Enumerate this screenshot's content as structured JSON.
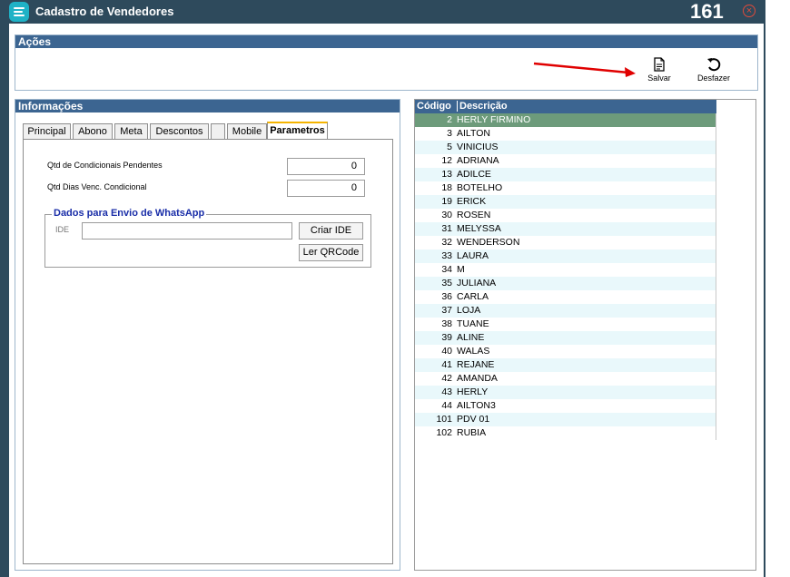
{
  "window": {
    "title": "Cadastro de Vendedores",
    "counter": "161",
    "close_glyph": "×"
  },
  "acoes": {
    "title": "Ações",
    "buttons": [
      {
        "label": "Salvar",
        "icon": "save-icon"
      },
      {
        "label": "Desfazer",
        "icon": "undo-icon"
      }
    ]
  },
  "informacoes": {
    "title": "Informações",
    "tabs": [
      "Principal",
      "Abono",
      "Meta",
      "Descontos",
      "",
      "Mobile",
      "Parametros"
    ],
    "active_tab": "Parametros",
    "fields": [
      {
        "label": "Qtd de Condicionais Pendentes",
        "value": "0"
      },
      {
        "label": "Qtd Dias Venc. Condicional",
        "value": "0"
      }
    ],
    "whatsapp": {
      "legend": "Dados para Envio de WhatsApp",
      "ide_label": "IDE",
      "ide_value": "",
      "criar_ide": "Criar IDE",
      "ler_qrcode": "Ler QRCode"
    }
  },
  "grid": {
    "headers": {
      "codigo": "Código",
      "descricao": "Descrição"
    },
    "selected_index": 0,
    "rows": [
      {
        "codigo": "2",
        "descricao": "HERLY  FIRMINO"
      },
      {
        "codigo": "3",
        "descricao": "AILTON"
      },
      {
        "codigo": "5",
        "descricao": "VINICIUS"
      },
      {
        "codigo": "12",
        "descricao": "ADRIANA"
      },
      {
        "codigo": "13",
        "descricao": "ADILCE"
      },
      {
        "codigo": "18",
        "descricao": "BOTELHO"
      },
      {
        "codigo": "19",
        "descricao": "ERICK"
      },
      {
        "codigo": "30",
        "descricao": "ROSEN"
      },
      {
        "codigo": "31",
        "descricao": "MELYSSA"
      },
      {
        "codigo": "32",
        "descricao": "WENDERSON"
      },
      {
        "codigo": "33",
        "descricao": "LAURA"
      },
      {
        "codigo": "34",
        "descricao": "M"
      },
      {
        "codigo": "35",
        "descricao": "JULIANA"
      },
      {
        "codigo": "36",
        "descricao": "CARLA"
      },
      {
        "codigo": "37",
        "descricao": "LOJA"
      },
      {
        "codigo": "38",
        "descricao": "TUANE"
      },
      {
        "codigo": "39",
        "descricao": "ALINE"
      },
      {
        "codigo": "40",
        "descricao": "WALAS"
      },
      {
        "codigo": "41",
        "descricao": "REJANE"
      },
      {
        "codigo": "42",
        "descricao": "AMANDA"
      },
      {
        "codigo": "43",
        "descricao": "HERLY"
      },
      {
        "codigo": "44",
        "descricao": "AILTON3"
      },
      {
        "codigo": "101",
        "descricao": "PDV 01"
      },
      {
        "codigo": "102",
        "descricao": "RUBIA"
      }
    ]
  },
  "colors": {
    "titlebar": "#2e4a5c",
    "panel_header": "#3c6591",
    "selected_row": "#6d9b7b",
    "alt_row": "#e9f8fb",
    "annotation_arrow": "#e00000",
    "whatsapp_legend": "#1a2ea8",
    "logo": "#1fb2c6"
  }
}
